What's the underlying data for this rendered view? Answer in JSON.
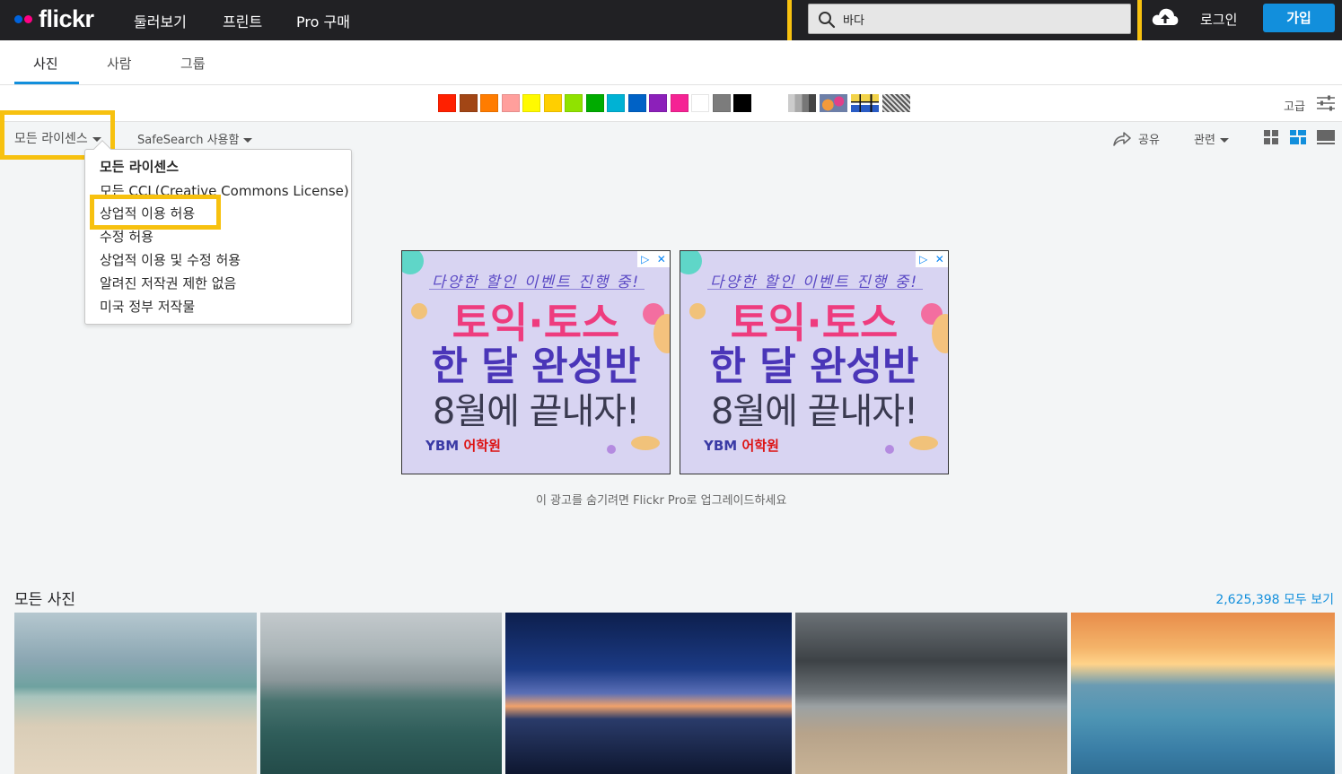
{
  "nav": {
    "logo_text": "flickr",
    "links": [
      "둘러보기",
      "프린트",
      "Pro 구매"
    ],
    "search_value": "바다",
    "login_label": "로그인",
    "signup_label": "가입"
  },
  "tabs": [
    "사진",
    "사람",
    "그룹"
  ],
  "colors": [
    "#ff2000",
    "#a24615",
    "#ff7c00",
    "#ff9f9c",
    "#fffa00",
    "#ffcf00",
    "#90e200",
    "#00ab00",
    "#00b2d4",
    "#0062c6",
    "#8c20ba",
    "#f52394",
    "#ffffff",
    "#7c7c7c",
    "#000000"
  ],
  "advanced_label": "고급",
  "filters": {
    "license_label": "모든 라이센스",
    "safesearch_label": "SafeSearch 사용함",
    "share_label": "공유",
    "related_label": "관련"
  },
  "license_menu": [
    "모든 라이센스",
    "모든 CCL(Creative Commons License)",
    "상업적 이용 허용",
    "수정 허용",
    "상업적 이용 및 수정 허용",
    "알려진 저작권 제한 없음",
    "미국 정부 저작물"
  ],
  "ad": {
    "line1": "다양한 할인 이벤트 진행 중!",
    "line2": "토익·토스",
    "line3": "한 달 완성반",
    "line4": "8월에 끝내자!",
    "brand_mark": "YBM",
    "brand_sub": "어학원",
    "adchoices": "▷",
    "close": "✕"
  },
  "ad_hide_text": "이 광고를 숨기려면 Flickr Pro로 업그레이드하세요",
  "photos_section": {
    "title": "모든 사진",
    "count_link": "2,625,398 모두 보기"
  }
}
